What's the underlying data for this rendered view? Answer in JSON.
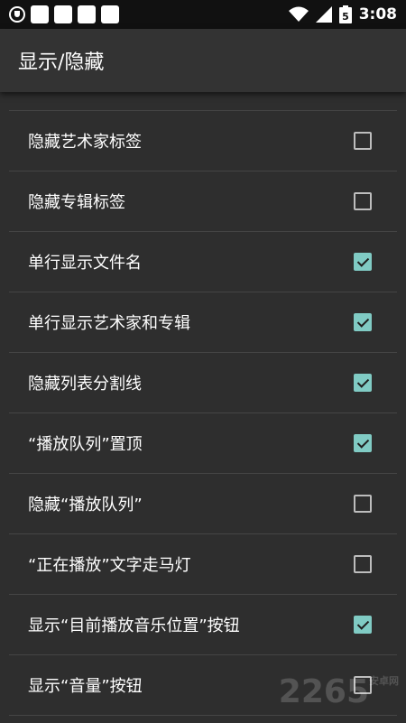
{
  "status_bar": {
    "time": "3:08",
    "battery_level": "5",
    "icons": [
      "shield-icon",
      "wifi-icon",
      "signal-icon",
      "battery-icon"
    ]
  },
  "app_bar": {
    "title": "显示/隐藏"
  },
  "settings": [
    {
      "label": "隐藏艺术家标签",
      "checked": false
    },
    {
      "label": "隐藏专辑标签",
      "checked": false
    },
    {
      "label": "单行显示文件名",
      "checked": true
    },
    {
      "label": "单行显示艺术家和专辑",
      "checked": true
    },
    {
      "label": "隐藏列表分割线",
      "checked": true
    },
    {
      "label": "“播放队列”置顶",
      "checked": true
    },
    {
      "label": "隐藏“播放队列”",
      "checked": false
    },
    {
      "label": "“正在播放”文字走马灯",
      "checked": false
    },
    {
      "label": "显示“目前播放音乐位置”按钮",
      "checked": true
    },
    {
      "label": "显示“音量”按钮",
      "checked": false
    }
  ],
  "watermark": {
    "text": "2265",
    "sub": "安卓网"
  },
  "colors": {
    "accent": "#80cbc4",
    "background": "#2e2e2e",
    "app_bar": "#333333"
  }
}
